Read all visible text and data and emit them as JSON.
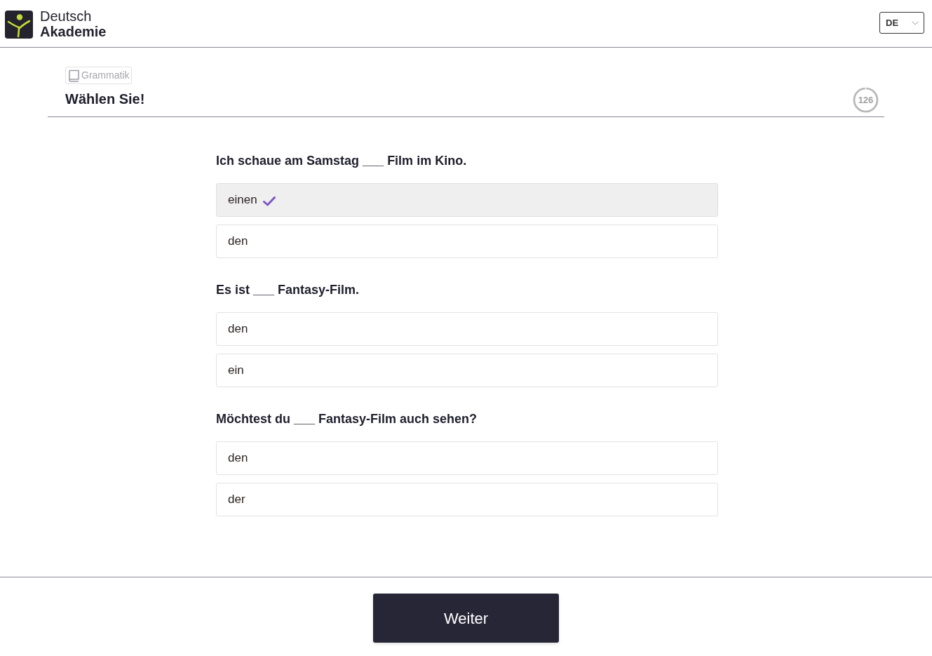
{
  "header": {
    "logo": {
      "line_1": "Deutsch",
      "line_2": "Akademie"
    },
    "language_select": {
      "value": "DE"
    }
  },
  "exercise": {
    "tag": "Grammatik",
    "title": "Wählen Sie!",
    "timer": {
      "value": "126",
      "level": 0.97
    }
  },
  "questions": [
    {
      "text": "Ich schaue am Samstag ___ Film im Kino.",
      "options": [
        {
          "label": "einen",
          "selected": true
        },
        {
          "label": "den",
          "selected": false
        }
      ]
    },
    {
      "text": "Es ist ___ Fantasy-Film.",
      "options": [
        {
          "label": "den",
          "selected": false
        },
        {
          "label": "ein",
          "selected": false
        }
      ]
    },
    {
      "text": "Möchtest du ___ Fantasy-Film auch sehen?",
      "options": [
        {
          "label": "den",
          "selected": false
        },
        {
          "label": "der",
          "selected": false
        }
      ]
    }
  ],
  "footer": {
    "next_button": "Weiter"
  }
}
